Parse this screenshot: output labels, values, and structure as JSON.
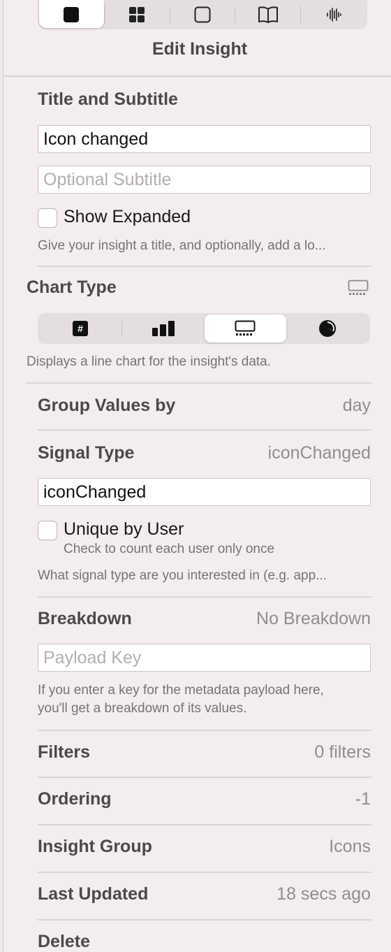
{
  "top_tabs": [
    {
      "icon": "square-filled-icon",
      "active": true
    },
    {
      "icon": "grid-icon",
      "active": false
    },
    {
      "icon": "square-outline-icon",
      "active": false
    },
    {
      "icon": "book-icon",
      "active": false
    },
    {
      "icon": "waveform-icon",
      "active": false
    }
  ],
  "panel_title": "Edit Insight",
  "title_section": {
    "heading": "Title and Subtitle",
    "title_value": "Icon changed",
    "subtitle_placeholder": "Optional Subtitle",
    "show_expanded_label": "Show Expanded",
    "help": "Give your insight a title, and optionally, add a lo..."
  },
  "chart_type": {
    "heading": "Chart Type",
    "current_icon": "line-chart-icon",
    "options": [
      {
        "icon": "number-icon",
        "active": false
      },
      {
        "icon": "bar-chart-icon",
        "active": false
      },
      {
        "icon": "line-chart-icon",
        "active": true
      },
      {
        "icon": "pie-chart-icon",
        "active": false
      }
    ],
    "help": "Displays a line chart for the insight's data."
  },
  "group_values": {
    "label": "Group Values by",
    "value": "day"
  },
  "signal_type": {
    "label": "Signal Type",
    "value": "iconChanged",
    "field_value": "iconChanged",
    "unique_label": "Unique by User",
    "unique_help": "Check to count each user only once",
    "help": "What signal type are you interested in (e.g. app..."
  },
  "breakdown": {
    "label": "Breakdown",
    "value": "No Breakdown",
    "placeholder": "Payload Key",
    "help_line1": "If you enter a key for the metadata payload here,",
    "help_line2": "you'll get a breakdown of its values."
  },
  "filters": {
    "label": "Filters",
    "value": "0 filters"
  },
  "ordering": {
    "label": "Ordering",
    "value": "-1"
  },
  "insight_group": {
    "label": "Insight Group",
    "value": "Icons"
  },
  "last_updated": {
    "label": "Last Updated",
    "value": "18 secs ago"
  },
  "delete": {
    "label": "Delete"
  }
}
